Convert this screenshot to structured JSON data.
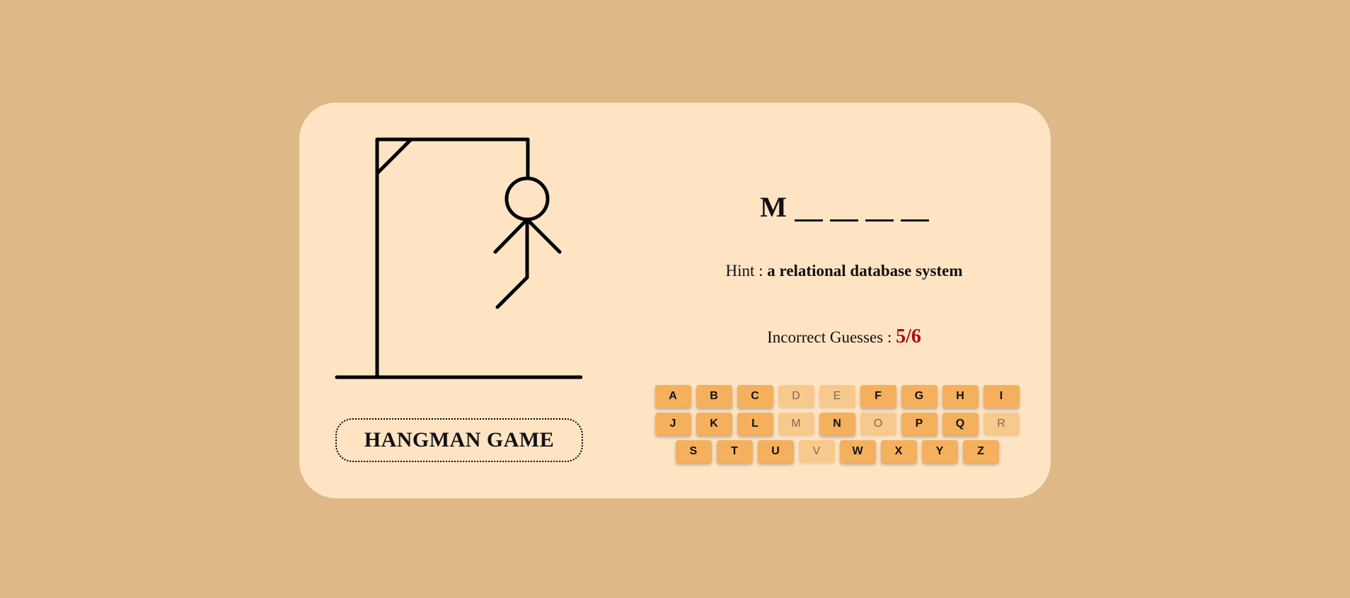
{
  "title": "HANGMAN GAME",
  "word": {
    "slots": [
      {
        "letter": "M",
        "revealed": true
      },
      {
        "letter": "",
        "revealed": false
      },
      {
        "letter": "",
        "revealed": false
      },
      {
        "letter": "",
        "revealed": false
      },
      {
        "letter": "",
        "revealed": false
      }
    ]
  },
  "hint": {
    "label": "Hint : ",
    "text": "a relational database system"
  },
  "guesses": {
    "label": "Incorrect Guesses : ",
    "count": "5/6"
  },
  "keyboard": {
    "rows": [
      [
        {
          "letter": "A",
          "used": false
        },
        {
          "letter": "B",
          "used": false
        },
        {
          "letter": "C",
          "used": false
        },
        {
          "letter": "D",
          "used": true
        },
        {
          "letter": "E",
          "used": true
        },
        {
          "letter": "F",
          "used": false
        },
        {
          "letter": "G",
          "used": false
        },
        {
          "letter": "H",
          "used": false
        },
        {
          "letter": "I",
          "used": false
        }
      ],
      [
        {
          "letter": "J",
          "used": false
        },
        {
          "letter": "K",
          "used": false
        },
        {
          "letter": "L",
          "used": false
        },
        {
          "letter": "M",
          "used": true
        },
        {
          "letter": "N",
          "used": false
        },
        {
          "letter": "O",
          "used": true
        },
        {
          "letter": "P",
          "used": false
        },
        {
          "letter": "Q",
          "used": false
        },
        {
          "letter": "R",
          "used": true
        }
      ],
      [
        {
          "letter": "S",
          "used": false
        },
        {
          "letter": "T",
          "used": false
        },
        {
          "letter": "U",
          "used": false
        },
        {
          "letter": "V",
          "used": true
        },
        {
          "letter": "W",
          "used": false
        },
        {
          "letter": "X",
          "used": false
        },
        {
          "letter": "Y",
          "used": false
        },
        {
          "letter": "Z",
          "used": false
        }
      ]
    ]
  },
  "drawing": {
    "body_parts_shown": [
      "head",
      "body",
      "left-arm",
      "right-arm",
      "left-leg"
    ]
  },
  "colors": {
    "background": "#deb887",
    "card": "#ffe4c4",
    "key": "#f4b05d",
    "key_used": "#f8c98c",
    "incorrect_count": "#a50f0f"
  }
}
